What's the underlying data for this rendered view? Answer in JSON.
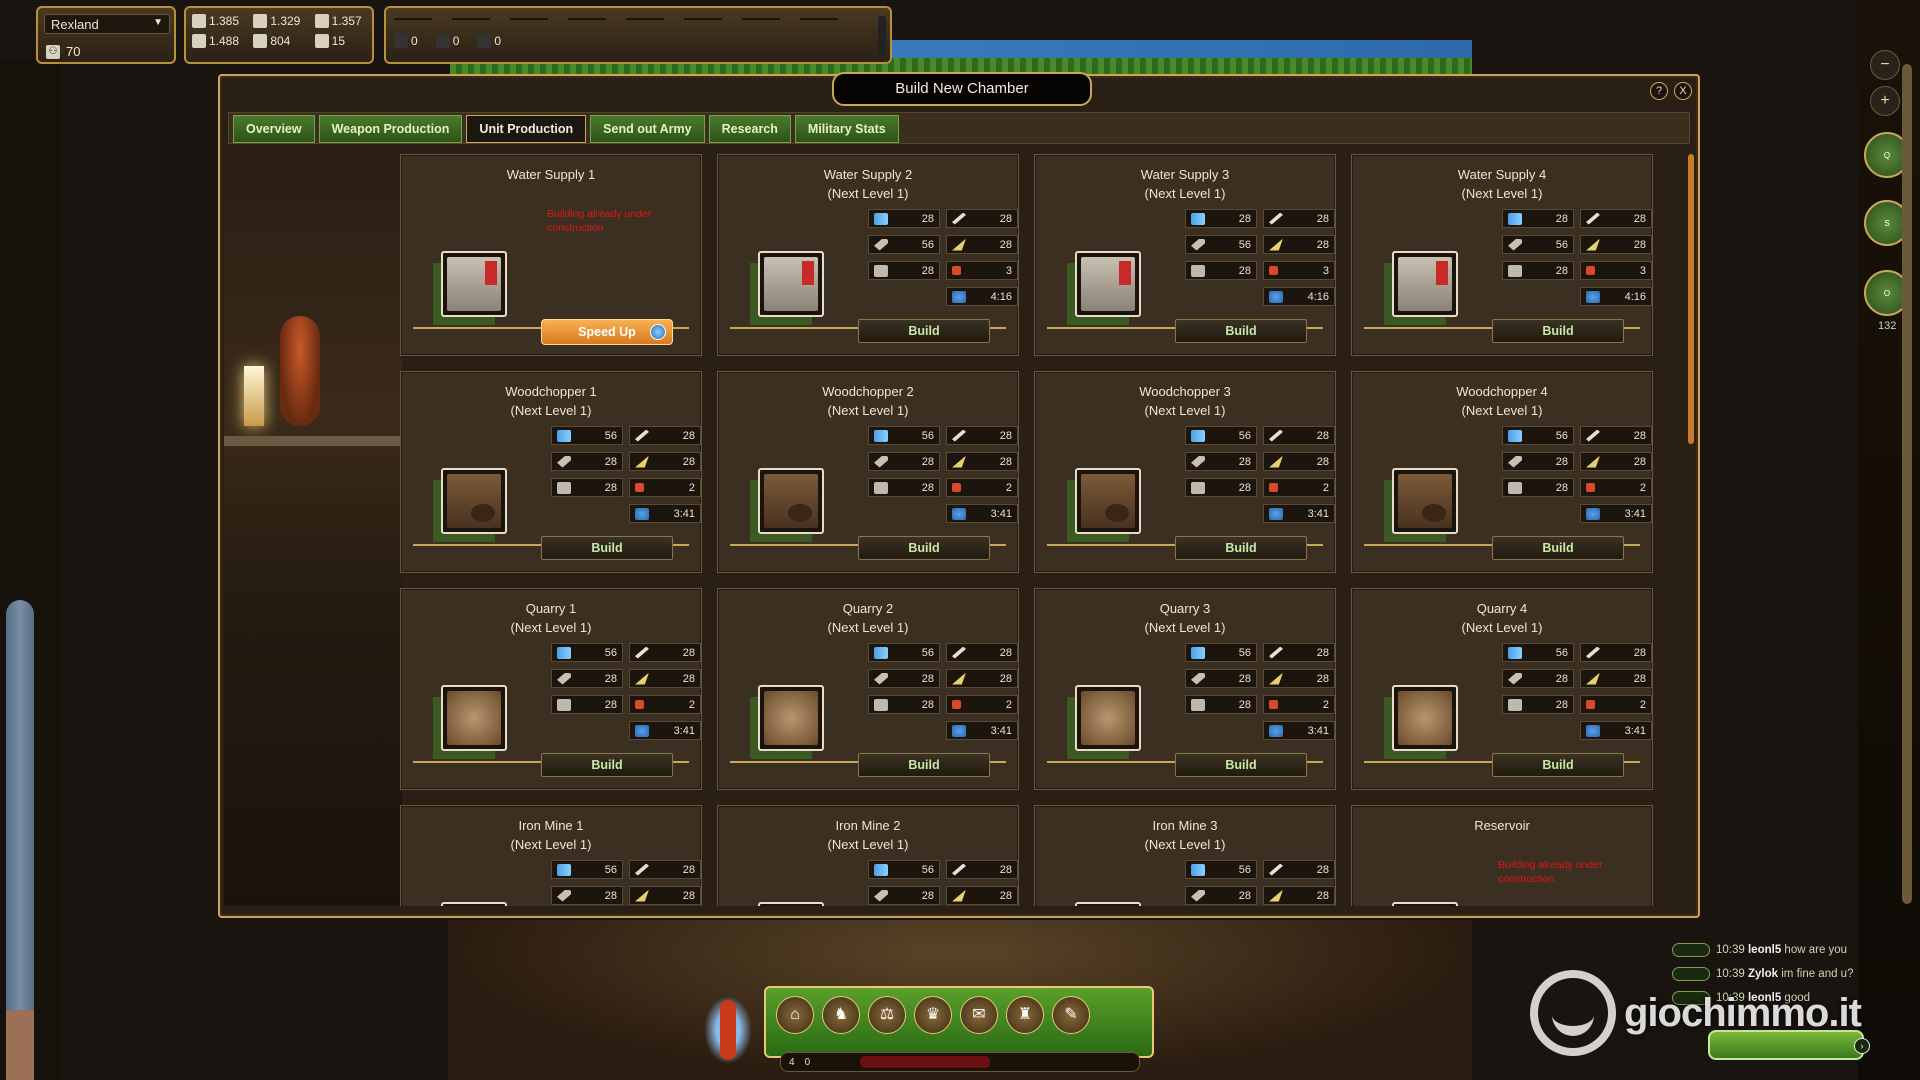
{
  "colony": {
    "name": "Rexland",
    "population": "70"
  },
  "resources": [
    {
      "icon": "wood-icon",
      "value": "1.385"
    },
    {
      "icon": "stone-icon",
      "value": "1.329"
    },
    {
      "icon": "axe-icon",
      "value": "1.357"
    },
    {
      "icon": "water-icon",
      "value": "1.488"
    },
    {
      "icon": "leaf-icon",
      "value": "804"
    },
    {
      "icon": "food-icon",
      "value": "15"
    }
  ],
  "army": [
    {
      "icon": "shield-icon",
      "value": "0"
    },
    {
      "icon": "flag-icon",
      "value": "0"
    },
    {
      "icon": "soldier-icon",
      "value": "0"
    }
  ],
  "window": {
    "title": "Build New Chamber",
    "help": "?",
    "close": "X",
    "tabs": [
      "Overview",
      "Weapon Production",
      "Unit Production",
      "Send out Army",
      "Research",
      "Military Stats"
    ],
    "active_tab": "Unit Production"
  },
  "cards": [
    {
      "title": "Water Supply 1",
      "subtitle": "",
      "status": "Building already under construction",
      "action": "Speed Up",
      "kind": "ws",
      "stats": []
    },
    {
      "title": "Water Supply 2",
      "subtitle": "(Next Level 1)",
      "status": "",
      "action": "Build",
      "kind": "ws",
      "stats": [
        "28",
        "28",
        "56",
        "28",
        "28",
        "3"
      ],
      "time": "4:16"
    },
    {
      "title": "Water Supply 3",
      "subtitle": "(Next Level 1)",
      "status": "",
      "action": "Build",
      "kind": "ws",
      "stats": [
        "28",
        "28",
        "56",
        "28",
        "28",
        "3"
      ],
      "time": "4:16"
    },
    {
      "title": "Water Supply 4",
      "subtitle": "(Next Level 1)",
      "status": "",
      "action": "Build",
      "kind": "ws",
      "stats": [
        "28",
        "28",
        "56",
        "28",
        "28",
        "3"
      ],
      "time": "4:16"
    },
    {
      "title": "Woodchopper 1",
      "subtitle": "(Next Level 1)",
      "status": "",
      "action": "Build",
      "kind": "wc",
      "stats": [
        "56",
        "28",
        "28",
        "28",
        "28",
        "2"
      ],
      "time": "3:41"
    },
    {
      "title": "Woodchopper 2",
      "subtitle": "(Next Level 1)",
      "status": "",
      "action": "Build",
      "kind": "wc",
      "stats": [
        "56",
        "28",
        "28",
        "28",
        "28",
        "2"
      ],
      "time": "3:41"
    },
    {
      "title": "Woodchopper 3",
      "subtitle": "(Next Level 1)",
      "status": "",
      "action": "Build",
      "kind": "wc",
      "stats": [
        "56",
        "28",
        "28",
        "28",
        "28",
        "2"
      ],
      "time": "3:41"
    },
    {
      "title": "Woodchopper 4",
      "subtitle": "(Next Level 1)",
      "status": "",
      "action": "Build",
      "kind": "wc",
      "stats": [
        "56",
        "28",
        "28",
        "28",
        "28",
        "2"
      ],
      "time": "3:41"
    },
    {
      "title": "Quarry 1",
      "subtitle": "(Next Level 1)",
      "status": "",
      "action": "Build",
      "kind": "qu",
      "stats": [
        "56",
        "28",
        "28",
        "28",
        "28",
        "2"
      ],
      "time": "3:41"
    },
    {
      "title": "Quarry 2",
      "subtitle": "(Next Level 1)",
      "status": "",
      "action": "Build",
      "kind": "qu",
      "stats": [
        "56",
        "28",
        "28",
        "28",
        "28",
        "2"
      ],
      "time": "3:41"
    },
    {
      "title": "Quarry 3",
      "subtitle": "(Next Level 1)",
      "status": "",
      "action": "Build",
      "kind": "qu",
      "stats": [
        "56",
        "28",
        "28",
        "28",
        "28",
        "2"
      ],
      "time": "3:41"
    },
    {
      "title": "Quarry 4",
      "subtitle": "(Next Level 1)",
      "status": "",
      "action": "Build",
      "kind": "qu",
      "stats": [
        "56",
        "28",
        "28",
        "28",
        "28",
        "2"
      ],
      "time": "3:41"
    },
    {
      "title": "Iron Mine 1",
      "subtitle": "(Next Level 1)",
      "status": "",
      "action": "",
      "kind": "im",
      "stats": [
        "56",
        "28",
        "28",
        "28"
      ]
    },
    {
      "title": "Iron Mine 2",
      "subtitle": "(Next Level 1)",
      "status": "",
      "action": "",
      "kind": "im",
      "stats": [
        "56",
        "28",
        "28",
        "28"
      ]
    },
    {
      "title": "Iron Mine 3",
      "subtitle": "(Next Level 1)",
      "status": "",
      "action": "",
      "kind": "im",
      "stats": [
        "56",
        "28",
        "28",
        "28"
      ]
    },
    {
      "title": "Reservoir",
      "subtitle": "",
      "status": "Building already under construction",
      "action": "",
      "kind": "rv",
      "stats": []
    }
  ],
  "side": {
    "online_count": "132"
  },
  "hud": {
    "count_a": "4",
    "count_b": "0"
  },
  "chat": [
    {
      "time": "10:39",
      "user": "leonl5",
      "text": "how are you"
    },
    {
      "time": "10:39",
      "user": "Zylok",
      "text": "im fine and u?"
    },
    {
      "time": "10:39",
      "user": "leonl5",
      "text": "good"
    }
  ],
  "watermark": "giochimmo.it",
  "colors": {
    "accent_gold": "#c8a858",
    "tab_green": "#4a7a2a",
    "status_red": "#e01818",
    "speedup_orange": "#f0a040"
  }
}
